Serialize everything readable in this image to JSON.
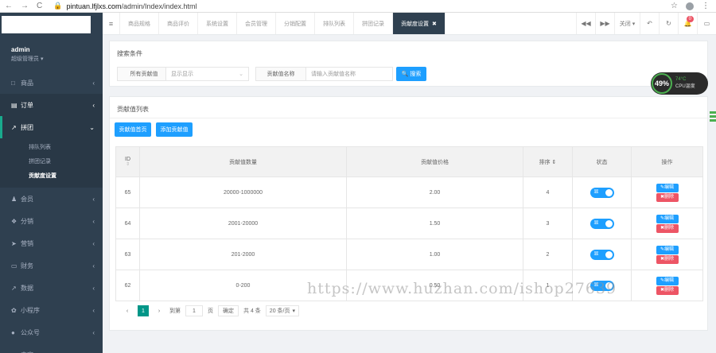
{
  "browser": {
    "url_host": "pintuan.lfjlxs.com",
    "url_path": "/admin/Index/index.html",
    "back": "←",
    "forward": "→",
    "reload": "C"
  },
  "sidebar": {
    "user_name": "admin",
    "user_role": "超级管理员 ▾",
    "items": [
      {
        "label": "商品",
        "icon": "□"
      },
      {
        "label": "订单",
        "icon": "▤"
      },
      {
        "label": "拼团",
        "icon": "↗"
      },
      {
        "label": "会员",
        "icon": "♟"
      },
      {
        "label": "分销",
        "icon": "❖"
      },
      {
        "label": "营销",
        "icon": "➤"
      },
      {
        "label": "财务",
        "icon": "▭"
      },
      {
        "label": "数据",
        "icon": "↗"
      },
      {
        "label": "小程序",
        "icon": "✿"
      },
      {
        "label": "公众号",
        "icon": "●"
      },
      {
        "label": "内容",
        "icon": "▥"
      }
    ],
    "subitems": [
      "排队列表",
      "拼团记录",
      "贡献度设置"
    ]
  },
  "tabs": [
    {
      "label": "商品规格"
    },
    {
      "label": "商品评价"
    },
    {
      "label": "系统设置"
    },
    {
      "label": "会员管理"
    },
    {
      "label": "分销配置"
    },
    {
      "label": "排队列表"
    },
    {
      "label": "拼团记录"
    },
    {
      "label": "贡献度设置",
      "close": "✖"
    }
  ],
  "toolbar": {
    "menu": "≡",
    "prev": "◀◀",
    "next": "▶▶",
    "close_menu": "关闭 ▾",
    "back": "↶",
    "refresh": "↻",
    "bell": "🔔",
    "notify_count": "0",
    "fullscreen": "▭"
  },
  "search": {
    "title": "搜索条件",
    "label1": "所有贡献值",
    "select_placeholder": "显示显示",
    "label2": "贡献值名称",
    "input_placeholder": "请输入贡献值名称",
    "button": "🔍 搜索"
  },
  "list": {
    "title": "贡献值列表",
    "btn_home": "贡献值首页",
    "btn_add": "添加贡献值",
    "headers": [
      "ID",
      "贡献值数量",
      "贡献值价格",
      "排序",
      "状态",
      "操作"
    ],
    "rows": [
      {
        "id": "65",
        "amount": "20000-1000000",
        "price": "2.00",
        "sort": "4"
      },
      {
        "id": "64",
        "amount": "2001-20000",
        "price": "1.50",
        "sort": "3"
      },
      {
        "id": "63",
        "amount": "201-2000",
        "price": "1.00",
        "sort": "2"
      },
      {
        "id": "62",
        "amount": "0-200",
        "price": "0.50",
        "sort": "1"
      }
    ],
    "switch_text": "显",
    "edit_label": "编辑",
    "delete_label": "删除",
    "edit_icon": "✎",
    "delete_icon": "✖"
  },
  "pager": {
    "prev": "‹",
    "current": "1",
    "next": "›",
    "goto_label": "到第",
    "goto_value": "1",
    "page_unit": "页",
    "confirm": "确定",
    "total": "共 4 条",
    "limit": "20 条/页",
    "limit_caret": "▾"
  },
  "cpu": {
    "percent": "49%",
    "temp": "74°C",
    "label": "CPU温度"
  },
  "watermark": "https://www.huzhan.com/ishop27639"
}
